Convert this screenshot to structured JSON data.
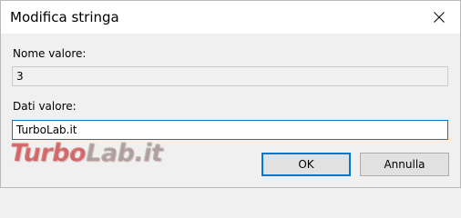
{
  "window": {
    "title": "Modifica stringa"
  },
  "form": {
    "nome_label": "Nome valore:",
    "nome_value": "3",
    "dati_label": "Dati valore:",
    "dati_value": "TurboLab.it"
  },
  "buttons": {
    "ok_label": "OK",
    "cancel_label": "Annulla"
  },
  "watermark": {
    "part1": "Turbo",
    "part2": "Lab.it"
  },
  "colors": {
    "accent": "#0078d7",
    "window_bg": "#f0f0f0",
    "titlebar_bg": "#ffffff",
    "button_bg": "#e1e1e1"
  },
  "icons": {
    "close": "close-icon"
  }
}
